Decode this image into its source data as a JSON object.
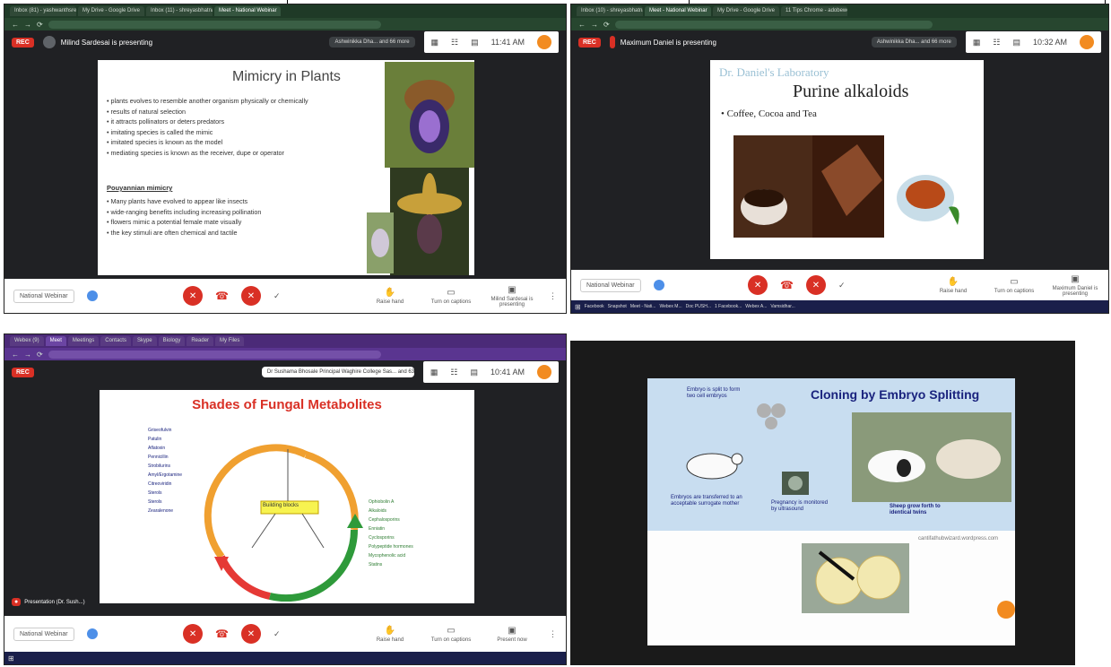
{
  "panel1": {
    "tabs": [
      "Inbox (81) - yashwanthsreekr",
      "My Drive - Google Drive",
      "Inbox (11) - shreyasbhatnagar",
      "Meet - National Webinar"
    ],
    "presenter": "Milind Sardesai is presenting",
    "participants_chip": "Ashwinikka Dha... and 66 more",
    "clock": "11:41 AM",
    "slide_title": "Mimicry in Plants",
    "bullets": [
      "plants evolves to resemble another organism physically or chemically",
      "results of natural selection",
      "it attracts pollinators or deters predators",
      "imitating species is called the mimic",
      "imitated species is known as the model",
      "mediating species is known as the receiver, dupe or operator"
    ],
    "subheading": "Pouyannian mimicry",
    "bullets2": [
      "Many plants have evolved to appear like insects",
      "wide-ranging benefits including increasing pollination",
      "flowers mimic a potential female mate visually",
      "the key stimuli are often chemical and tactile"
    ],
    "meeting_name": "National Webinar",
    "raise_hand": "Raise hand",
    "captions": "Turn on captions",
    "present": "Milind Sardesai is presenting"
  },
  "panel2": {
    "tabs": [
      "Inbox (10) - shreyasbhatnagar",
      "Meet - National Webinar",
      "My Drive - Google Drive",
      "11 Tips Chrome - adobewebinar"
    ],
    "presenter": "Maximum Daniel is presenting",
    "participants_chip": "Ashwinikka Dha... and 66 more",
    "clock": "10:32 AM",
    "logo": "Dr. Daniel's Laboratory",
    "slide_title": "Purine alkaloids",
    "bullet": "Coffee, Cocoa and Tea",
    "meeting_name": "National Webinar",
    "raise_hand": "Raise hand",
    "captions": "Turn on captions",
    "present": "Maximum Daniel is presenting",
    "taskbar": [
      "Facebook",
      "Snapshot",
      "Meet - Nati...",
      "Webex M...",
      "Doc PUSH...",
      "1 Facebook...",
      "Webex A...",
      "Vamsidhar..."
    ]
  },
  "panel3": {
    "tabs": [
      "Webex (9)",
      "Meet",
      "Meetings",
      "Contacts",
      "Skype",
      "Biology",
      "Reader",
      "My Files"
    ],
    "presenter_chip": "Dr Sushama Bhosale Principal Waghire College Sas... and 63 more",
    "clock": "10:41 AM",
    "slide_title": "Shades of Fungal Metabolites",
    "center_label": "Building blocks",
    "arc_labels_left": [
      "Griseofulvin",
      "Patulin",
      "Aflatoxin",
      "Pennicillin",
      "Strobilurins",
      "Amyl/Ergotamine",
      "Citreoviridin",
      "Sterols",
      "Sterols",
      "Zearalenone"
    ],
    "arc_labels_right": [
      "Ophiobolin A",
      "Alkaloids",
      "Cephalosporins",
      "Enniatin",
      "Cyclosporins",
      "Polypeptide hormones",
      "Mycophenolic acid",
      "Statins"
    ],
    "presenter_label": "Presentation (Dr. Sush...)",
    "meeting_name": "National Webinar",
    "raise_hand": "Raise hand",
    "captions": "Turn on captions",
    "present": "Present now"
  },
  "panel4": {
    "slide_title": "Cloning by Embryo Splitting",
    "cap_embryo": "Embryo is split to form two cell embryos",
    "cap_transfer": "Embryos are transferred to an acceptable surrogate mother",
    "cap_pregnancy": "Pregnancy is monitored by ultrasound",
    "cap_born": "Sheep grow forth to identical twins",
    "cap_source": "cantifathubwizard.wordpress.com"
  },
  "colors": {
    "meet_dark": "#202124",
    "record_red": "#d93025",
    "accent_orange": "#f28b20",
    "chrome_green": "#1f3a27",
    "chrome_purple": "#4b2a78",
    "fungal_title_red": "#d93025",
    "cloning_title_navy": "#1a237e"
  }
}
